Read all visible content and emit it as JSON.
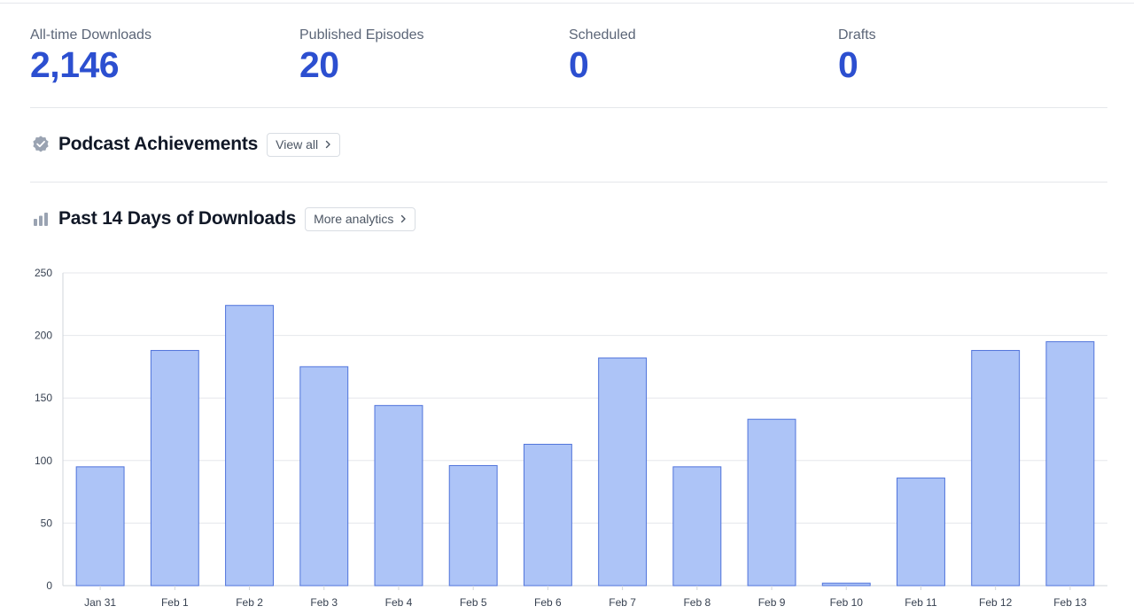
{
  "stats": [
    {
      "label": "All-time Downloads",
      "value": "2,146"
    },
    {
      "label": "Published Episodes",
      "value": "20"
    },
    {
      "label": "Scheduled",
      "value": "0"
    },
    {
      "label": "Drafts",
      "value": "0"
    }
  ],
  "achievements": {
    "title": "Podcast Achievements",
    "button_label": "View all",
    "icon": "verified-badge-icon"
  },
  "downloads": {
    "title": "Past 14 Days of Downloads",
    "button_label": "More analytics",
    "icon": "bar-chart-icon"
  },
  "colors": {
    "accent": "#2c4fd0",
    "bar_fill": "#adc4f7",
    "bar_stroke": "#4f73db",
    "grid": "#e5e7eb"
  },
  "chart_data": {
    "type": "bar",
    "categories": [
      "Jan 31",
      "Feb 1",
      "Feb 2",
      "Feb 3",
      "Feb 4",
      "Feb 5",
      "Feb 6",
      "Feb 7",
      "Feb 8",
      "Feb 9",
      "Feb 10",
      "Feb 11",
      "Feb 12",
      "Feb 13"
    ],
    "values": [
      95,
      188,
      224,
      175,
      144,
      96,
      113,
      182,
      95,
      133,
      2,
      86,
      188,
      195
    ],
    "title": "",
    "xlabel": "",
    "ylabel": "",
    "ylim": [
      0,
      250
    ],
    "yticks": [
      0,
      50,
      100,
      150,
      200,
      250
    ],
    "grid": true,
    "legend": "none"
  }
}
